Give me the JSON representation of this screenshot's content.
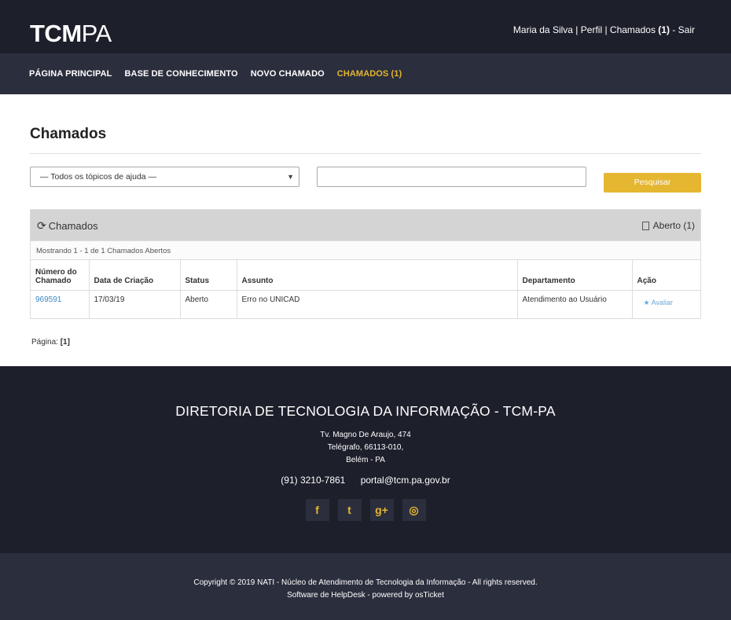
{
  "brand": {
    "logo_bold": "TC",
    "logo_m": "M",
    "logo_light": "PA"
  },
  "userbar": {
    "name": "Maria da Silva",
    "sep1": "|",
    "profile": "Perfil",
    "sep2": "|",
    "tickets_label": "Chamados",
    "tickets_count": "(1)",
    "dash": "-",
    "logout": "Sair"
  },
  "nav": {
    "home": "PÁGINA PRINCIPAL",
    "kb": "BASE DE CONHECIMENTO",
    "new": "NOVO CHAMADO",
    "tickets": "CHAMADOS (1)"
  },
  "page": {
    "title": "Chamados"
  },
  "filters": {
    "topic_selected": "— Todos os tópicos de ajuda —",
    "search_value": "",
    "search_button": "Pesquisar"
  },
  "panel": {
    "title": "Chamados",
    "status_filter": "Aberto (1)",
    "showing": "Mostrando 1 - 1 de 1 Chamados Abertos"
  },
  "table": {
    "headers": {
      "number_l1": "Número do",
      "number_l2": "Chamado",
      "created": "Data de Criação",
      "status": "Status",
      "subject": "Assunto",
      "department": "Departamento",
      "action": "Ação"
    },
    "rows": [
      {
        "number": "969591",
        "created": "17/03/19",
        "status": "Aberto",
        "subject": "Erro no UNICAD",
        "department": "Atendimento ao Usuário",
        "action": "Avaliar"
      }
    ]
  },
  "pager": {
    "label": "Página:",
    "current": "[1]"
  },
  "footer": {
    "title": "DIRETORIA DE TECNOLOGIA DA INFORMAÇÃO - TCM-PA",
    "addr1": "Tv. Magno De Araujo, 474",
    "addr2": "Telégrafo, 66113-010,",
    "addr3": "Belém - PA",
    "phone": "(91) 3210-7861",
    "email": "portal@tcm.pa.gov.br",
    "social": {
      "facebook": "f",
      "twitter": "t",
      "gplus": "g+",
      "instagram": "◎"
    }
  },
  "copyright": {
    "line1": "Copyright © 2019 NATI - Núcleo de Atendimento de Tecnologia da Informação - All rights reserved.",
    "line2": "Software de HelpDesk - powered by osTicket"
  },
  "colors": {
    "accent": "#e5b630",
    "dark": "#1d1f2b",
    "nav": "#2b2e3d",
    "link": "#3a87c2"
  }
}
